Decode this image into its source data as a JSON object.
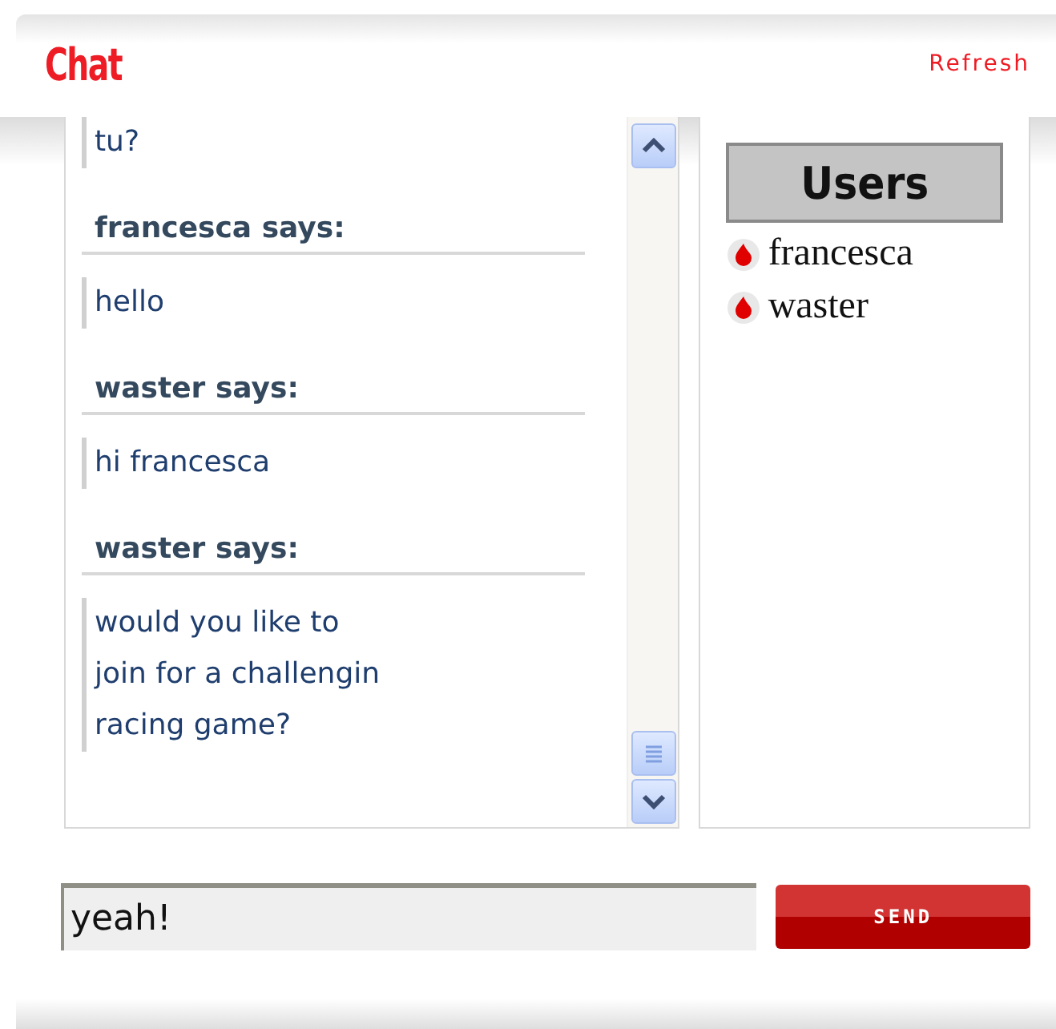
{
  "header": {
    "title": "Chat",
    "refresh": "Refresh"
  },
  "messages": [
    {
      "kind": "text",
      "text": "tu?"
    },
    {
      "kind": "author",
      "text": "francesca says:"
    },
    {
      "kind": "text",
      "text": "hello"
    },
    {
      "kind": "author",
      "text": "waster says:"
    },
    {
      "kind": "text",
      "text": "hi francesca"
    },
    {
      "kind": "author",
      "text": "waster says:"
    },
    {
      "kind": "text",
      "text": "would you like to\njoin for a challengin\nracing game?"
    }
  ],
  "users": {
    "title": "Users",
    "items": [
      "francesca",
      "waster"
    ]
  },
  "composer": {
    "value": "yeah!",
    "send": "SEND"
  }
}
